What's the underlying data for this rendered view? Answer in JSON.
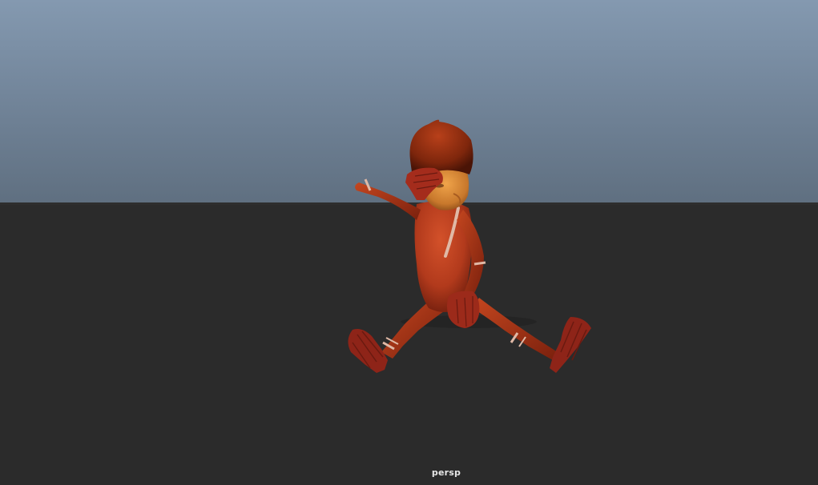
{
  "viewport": {
    "camera_name": "persp"
  },
  "colors": {
    "sky_top": "#8499b0",
    "sky_bottom": "#5f6f80",
    "ground": "#2b2b2b",
    "suit": "#b0391c",
    "skin": "#d98a3a",
    "hair": "#8c2a0e",
    "stripe": "#e0b9a6"
  }
}
